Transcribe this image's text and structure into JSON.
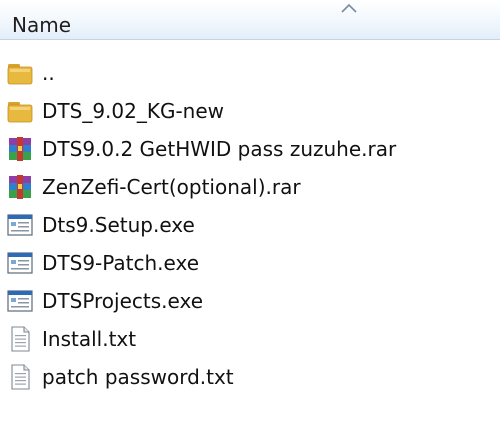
{
  "header": {
    "column_name": "Name",
    "sort": "ascending"
  },
  "files": [
    {
      "name": "..",
      "type": "folder-icon"
    },
    {
      "name": "DTS_9.02_KG-new",
      "type": "folder-icon"
    },
    {
      "name": "DTS9.0.2 GetHWID pass zuzuhe.rar",
      "type": "winrar-archive-icon"
    },
    {
      "name": "ZenZefi-Cert(optional).rar",
      "type": "winrar-archive-icon"
    },
    {
      "name": "Dts9.Setup.exe",
      "type": "exe-application-icon"
    },
    {
      "name": "DTS9-Patch.exe",
      "type": "exe-application-icon"
    },
    {
      "name": "DTSProjects.exe",
      "type": "exe-application-icon"
    },
    {
      "name": "Install.txt",
      "type": "text-file-icon"
    },
    {
      "name": "patch password.txt",
      "type": "text-file-icon"
    }
  ],
  "colors": {
    "folder": "#e8b93f",
    "header_gradient_end": "#e3eef9",
    "exe_title_bar": "#2d6bb8"
  }
}
